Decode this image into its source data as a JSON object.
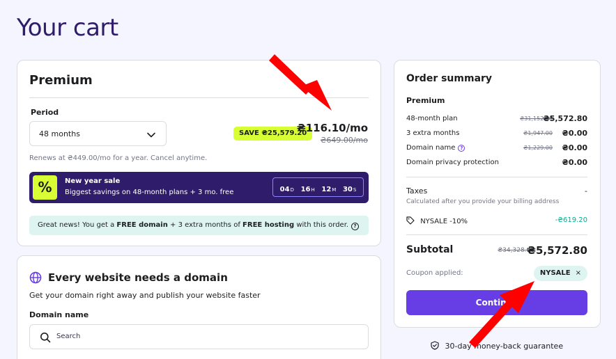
{
  "page": {
    "title": "Your cart"
  },
  "plan": {
    "title": "Premium",
    "period_label": "Period",
    "period_value": "48 months",
    "save_badge": "SAVE ₴25,579.20",
    "price": "₴116.10/mo",
    "old_price": "₴649.00/mo",
    "renew_text": "Renews at ₴449.00/mo for a year. Cancel anytime.",
    "sale": {
      "title": "New year sale",
      "subtitle": "Biggest savings on 48-month plans + 3 mo. free",
      "badge": "%",
      "timer": [
        {
          "num": "04",
          "unit": "D"
        },
        {
          "num": "16",
          "unit": "H"
        },
        {
          "num": "12",
          "unit": "M"
        },
        {
          "num": "30",
          "unit": "S"
        }
      ]
    },
    "info": {
      "t1": "Great news! You get a ",
      "b1": "FREE domain",
      "t2": " + 3 extra months of ",
      "b2": "FREE hosting",
      "t3": " with this order."
    }
  },
  "domain": {
    "title": "Every website needs a domain",
    "subtitle": "Get your domain right away and publish your website faster",
    "label": "Domain name",
    "search_placeholder": "Search"
  },
  "summary": {
    "title": "Order summary",
    "plan": "Premium",
    "items": [
      {
        "label": "48-month plan",
        "strike": "₴31,152.00",
        "amount": "₴5,572.80"
      },
      {
        "label": "3 extra months",
        "strike": "₴1,947.00",
        "amount": "₴0.00"
      },
      {
        "label": "Domain name",
        "strike": "₴1,229.00",
        "amount": "₴0.00"
      },
      {
        "label": "Domain privacy protection",
        "strike": "",
        "amount": "₴0.00"
      }
    ],
    "taxes_label": "Taxes",
    "taxes_value": "-",
    "taxes_note": "Calculated after you provide your billing address",
    "coupon_line": "NYSALE -10%",
    "coupon_discount": "-₴619.20",
    "subtotal_label": "Subtotal",
    "subtotal_strike": "₴34,328.00",
    "subtotal_amount": "₴5,572.80",
    "coupon_applied_label": "Coupon applied:",
    "coupon_code": "NYSALE",
    "coupon_remove": "×",
    "continue_label": "Continue"
  },
  "footer": {
    "guarantee": "30-day money-back guarantee"
  },
  "colors": {
    "accent": "#673de6",
    "lime": "#d8ff33",
    "dark": "#2f1c6a",
    "mint": "#def4f0",
    "annotation": "#ff0000"
  }
}
